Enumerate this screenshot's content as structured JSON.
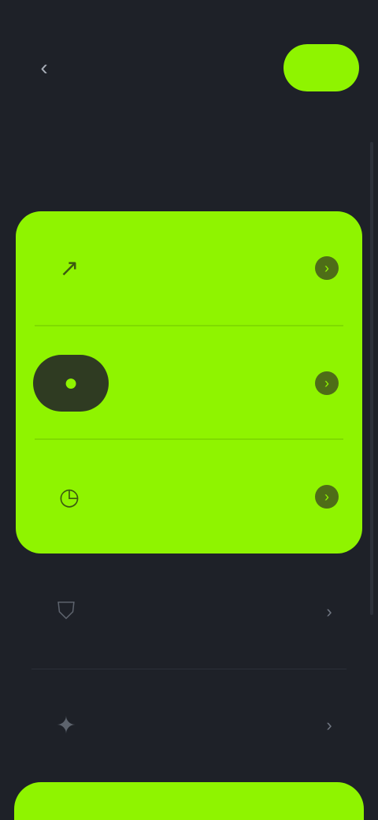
{
  "status_bar": {
    "time": "",
    "indicators": ""
  },
  "header": {
    "back_icon": "chevron-left-icon",
    "action_label": "",
    "title": ""
  },
  "section": {
    "label": ""
  },
  "menu": {
    "highlighted": [
      {
        "label": "",
        "icon": "arrow-icon"
      },
      {
        "label": "",
        "icon": "bulb-icon"
      },
      {
        "label": "",
        "icon": "clock-icon"
      }
    ],
    "plain": [
      {
        "label": "",
        "icon": "shield-icon"
      },
      {
        "label": "",
        "icon": "star-icon"
      }
    ]
  },
  "footer": {
    "primary_label": ""
  },
  "colors": {
    "accent": "#8ff400",
    "background": "#1e2128"
  }
}
